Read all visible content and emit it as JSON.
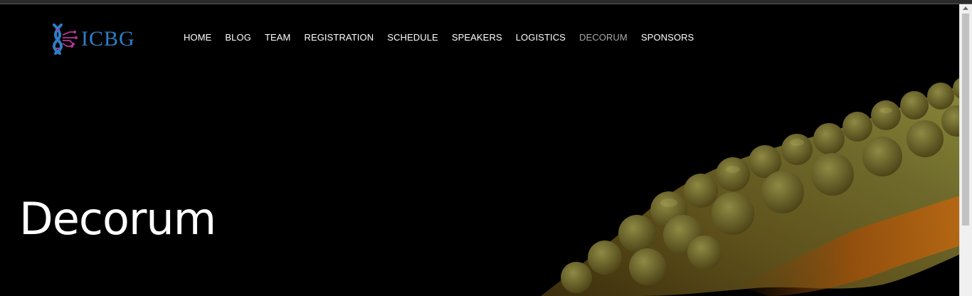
{
  "brand": {
    "logo_text": "ICBG",
    "logo_icon": "dna-circuit-icon"
  },
  "nav": {
    "items": [
      {
        "label": "HOME",
        "active": false
      },
      {
        "label": "BLOG",
        "active": false
      },
      {
        "label": "TEAM",
        "active": false
      },
      {
        "label": "REGISTRATION",
        "active": false
      },
      {
        "label": "SCHEDULE",
        "active": false
      },
      {
        "label": "SPEAKERS",
        "active": false
      },
      {
        "label": "LOGISTICS",
        "active": false
      },
      {
        "label": "DECORUM",
        "active": true
      },
      {
        "label": "SPONSORS",
        "active": false
      }
    ]
  },
  "hero": {
    "title": "Decorum"
  },
  "colors": {
    "background": "#000000",
    "nav_text": "#ffffff",
    "nav_active": "#a9a9a9",
    "logo_blue": "#2c7fc6",
    "logo_magenta": "#b8359a"
  }
}
